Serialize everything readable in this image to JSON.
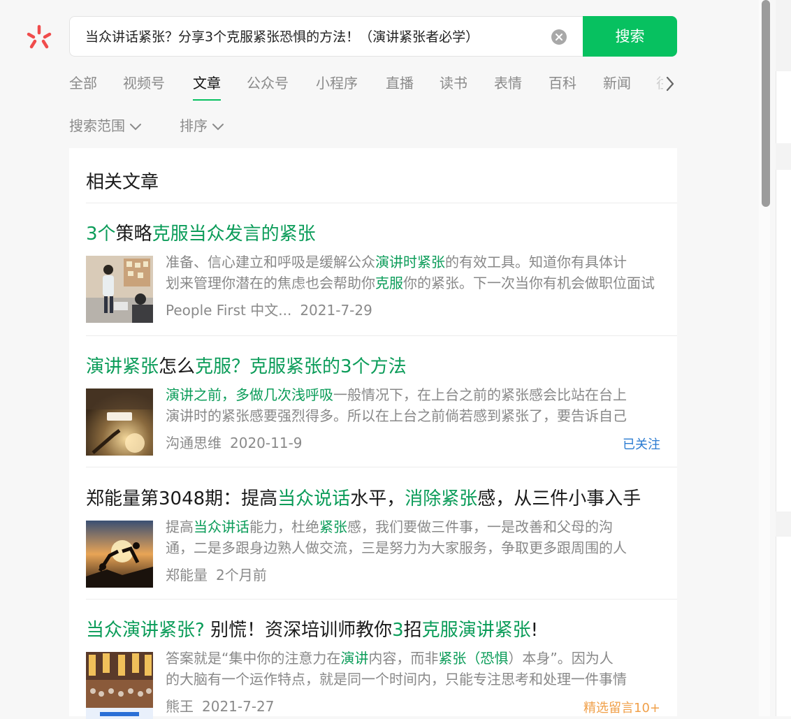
{
  "search": {
    "query": "当众讲话紧张？分享3个克服紧张恐惧的方法！（演讲紧张者必学）",
    "button_label": "搜索"
  },
  "tabs": [
    {
      "label": "全部",
      "active": false
    },
    {
      "label": "视频号",
      "active": false
    },
    {
      "label": "文章",
      "active": true
    },
    {
      "label": "公众号",
      "active": false
    },
    {
      "label": "小程序",
      "active": false
    },
    {
      "label": "直播",
      "active": false
    },
    {
      "label": "读书",
      "active": false
    },
    {
      "label": "表情",
      "active": false
    },
    {
      "label": "百科",
      "active": false
    },
    {
      "label": "新闻",
      "active": false
    }
  ],
  "filters": {
    "scope_label": "搜索范围",
    "sort_label": "排序"
  },
  "panel": {
    "title": "相关文章"
  },
  "articles": [
    {
      "title_parts": [
        {
          "t": "3个",
          "hl": true
        },
        {
          "t": "策略",
          "hl": false
        },
        {
          "t": "克服当众发言的紧张",
          "hl": true
        }
      ],
      "summary_lines": [
        [
          {
            "t": "准备、信心建立和呼吸是缓解公众",
            "hl": false
          },
          {
            "t": "演讲时紧张",
            "hl": true
          },
          {
            "t": "的有效工具。知道你有具体计",
            "hl": false
          }
        ],
        [
          {
            "t": "划来管理你潜在的焦虑也会帮助你",
            "hl": false
          },
          {
            "t": "克服",
            "hl": true
          },
          {
            "t": "你的紧张。下一次当你有机会做职位面试",
            "hl": false
          }
        ]
      ],
      "source": "People First 中文...",
      "date": "2021-7-29",
      "badge": ""
    },
    {
      "title_parts": [
        {
          "t": "演讲紧张",
          "hl": true
        },
        {
          "t": "怎么",
          "hl": false
        },
        {
          "t": "克服？克服紧张的3个方法",
          "hl": true
        }
      ],
      "summary_lines": [
        [
          {
            "t": "演讲之前，多做几次浅呼吸",
            "hl": true
          },
          {
            "t": "一般情况下，在上台之前的紧张感会比站在台上",
            "hl": false
          }
        ],
        [
          {
            "t": "演讲时的紧张感要强烈得多。所以在上台之前倘若感到紧张了，要告诉自己",
            "hl": false
          }
        ]
      ],
      "source": "沟通思维",
      "date": "2020-11-9",
      "badge": "已关注",
      "badge_color": "#2a7bd1"
    },
    {
      "title_parts": [
        {
          "t": "郑能量第3048期：提高",
          "hl": false
        },
        {
          "t": "当众说话",
          "hl": true
        },
        {
          "t": "水平，",
          "hl": false
        },
        {
          "t": "消除紧张",
          "hl": true
        },
        {
          "t": "感，从三件小事入手",
          "hl": false
        }
      ],
      "summary_lines": [
        [
          {
            "t": "提高",
            "hl": false
          },
          {
            "t": "当众讲话",
            "hl": true
          },
          {
            "t": "能力，杜绝",
            "hl": false
          },
          {
            "t": "紧张",
            "hl": true
          },
          {
            "t": "感，我们要做三件事，一是改善和父母的沟",
            "hl": false
          }
        ],
        [
          {
            "t": "通，二是多跟身边熟人做交流，三是努力为大家服务，争取更多跟周围的人",
            "hl": false
          }
        ]
      ],
      "source": "郑能量",
      "date": "2个月前",
      "badge": ""
    },
    {
      "title_parts": [
        {
          "t": "当众演讲紧张?",
          "hl": true
        },
        {
          "t": " 别慌！资深培训师教你",
          "hl": false
        },
        {
          "t": "3",
          "hl": true
        },
        {
          "t": "招",
          "hl": false
        },
        {
          "t": "克服演讲紧张",
          "hl": true
        },
        {
          "t": "!",
          "hl": false
        }
      ],
      "summary_lines": [
        [
          {
            "t": "答案就是“集中你的注意力在",
            "hl": false
          },
          {
            "t": "演讲",
            "hl": true
          },
          {
            "t": "内容，而非",
            "hl": false
          },
          {
            "t": "紧张（恐惧",
            "hl": true
          },
          {
            "t": "）本身”。因为人",
            "hl": false
          }
        ],
        [
          {
            "t": "的大脑有一个运作特点，就是同一个时间内，只能专注思考和处理一件事情",
            "hl": false
          }
        ]
      ],
      "source": "熊王",
      "date": "2021-7-27",
      "badge": "精选留言10+",
      "badge_color": "#f0a04a"
    }
  ]
}
